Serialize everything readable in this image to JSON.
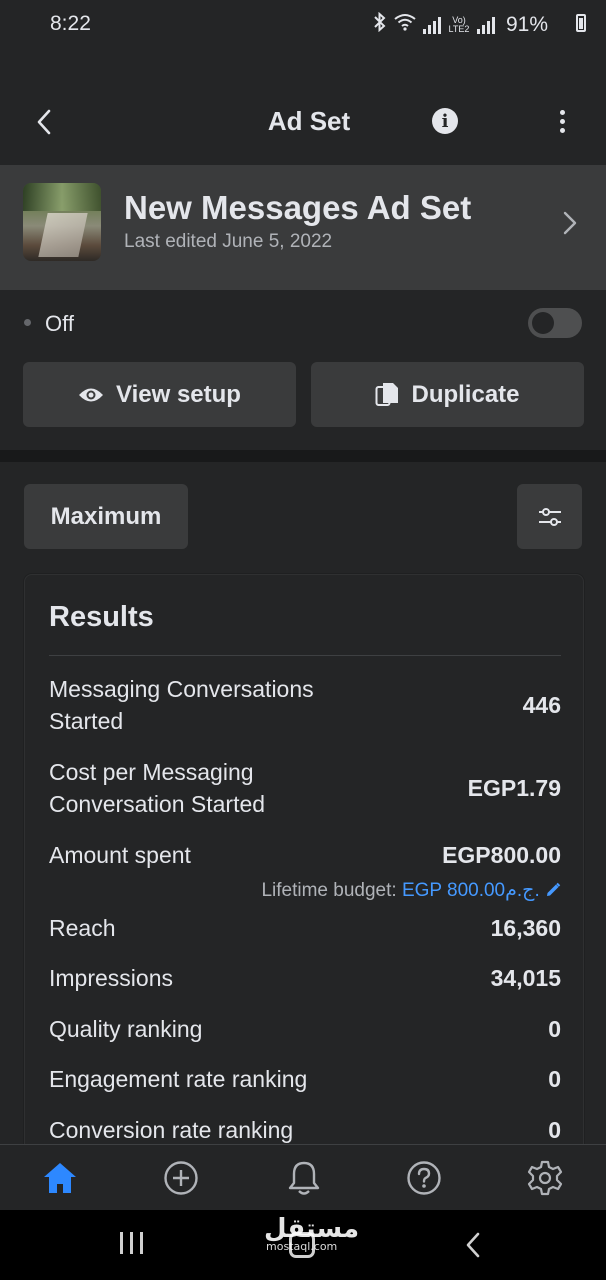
{
  "status_bar": {
    "time": "8:22",
    "network_label": "Vo) LTE2",
    "battery": "91%",
    "icons": [
      "bluetooth-icon",
      "wifi-icon",
      "signal-icon",
      "signal-icon",
      "battery-icon"
    ]
  },
  "app_bar": {
    "title": "Ad Set",
    "icons": [
      "back-chevron-icon",
      "info-icon",
      "more-vertical-icon"
    ]
  },
  "ad_set": {
    "name": "New Messages Ad Set",
    "last_edited": "Last edited June 5, 2022"
  },
  "delivery": {
    "status_label": "Off",
    "toggle_on": false
  },
  "actions": {
    "view_setup": "View setup",
    "duplicate": "Duplicate"
  },
  "filters": {
    "date_range": "Maximum",
    "filter_icon": "sliders-icon"
  },
  "results": {
    "title": "Results",
    "metrics": [
      {
        "label": "Messaging Conversations Started",
        "value": "446"
      },
      {
        "label": "Cost per Messaging Conversation Started",
        "value": "EGP1.79"
      },
      {
        "label": "Amount spent",
        "value": "EGP800.00",
        "budget_label": "Lifetime budget:",
        "budget_value": "EGP 800.00ج.م."
      },
      {
        "label": "Reach",
        "value": "16,360"
      },
      {
        "label": "Impressions",
        "value": "34,015"
      },
      {
        "label": "Quality ranking",
        "value": "0"
      },
      {
        "label": "Engagement rate ranking",
        "value": "0"
      },
      {
        "label": "Conversion rate ranking",
        "value": "0"
      }
    ]
  },
  "bottom_nav": {
    "items": [
      "home-icon",
      "create-icon",
      "notifications-icon",
      "help-icon",
      "settings-icon"
    ],
    "active": "home-icon",
    "accent_color": "#2d88ff"
  },
  "watermark": {
    "arabic": "مستقل",
    "latin": "mostaql.com"
  }
}
